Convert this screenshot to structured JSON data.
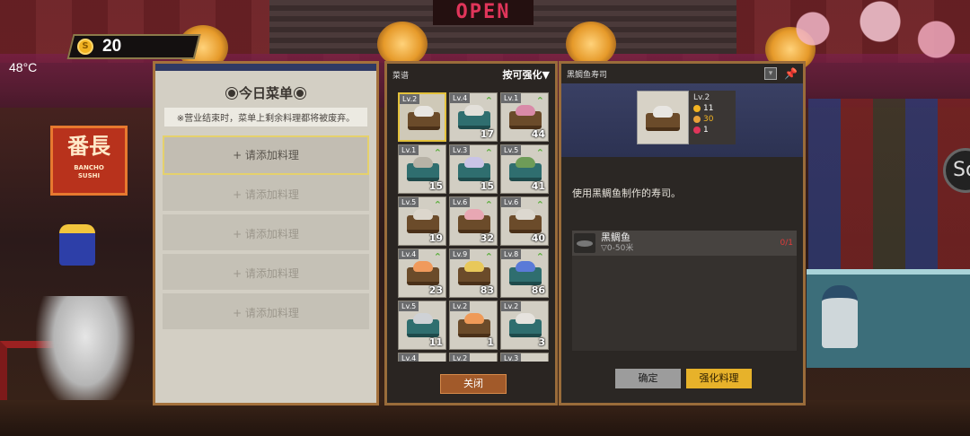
{
  "hud": {
    "temperature": "48°C",
    "coins": "20",
    "coin_symbol": "S",
    "open_sign": "OPEN",
    "side_button": "So"
  },
  "signboard": {
    "name": "番長",
    "sub1": "BANCHO",
    "sub2": "SUSHI"
  },
  "today_menu": {
    "title": "今日菜单",
    "note": "※营业结束时，菜单上剩余料理都将被废弃。",
    "slots": [
      "+ 请添加料理",
      "+ 请添加料理",
      "+ 请添加料理",
      "+ 请添加料理",
      "+ 请添加料理"
    ]
  },
  "recipes": {
    "title": "菜谱",
    "sort_label": "按可强化▼",
    "close_label": "关闭",
    "items": [
      {
        "level": "Lv.2",
        "count": "",
        "upgrade": false,
        "selected": true,
        "fish": "#e8e6e2",
        "plate": "wood"
      },
      {
        "level": "Lv.4",
        "count": "17",
        "upgrade": true,
        "selected": false,
        "fish": "#e3e0da",
        "plate": "teal"
      },
      {
        "level": "Lv.1",
        "count": "44",
        "upgrade": true,
        "selected": false,
        "fish": "#d98aa8",
        "plate": "wood"
      },
      {
        "level": "Lv.1",
        "count": "15",
        "upgrade": true,
        "selected": false,
        "fish": "#b7b2a6",
        "plate": "teal"
      },
      {
        "level": "Lv.3",
        "count": "15",
        "upgrade": true,
        "selected": false,
        "fish": "#c9c4e6",
        "plate": "teal"
      },
      {
        "level": "Lv.5",
        "count": "41",
        "upgrade": true,
        "selected": false,
        "fish": "#6e9c58",
        "plate": "teal"
      },
      {
        "level": "Lv.5",
        "count": "19",
        "upgrade": true,
        "selected": false,
        "fish": "#dcd6cc",
        "plate": "wood"
      },
      {
        "level": "Lv.6",
        "count": "32",
        "upgrade": true,
        "selected": false,
        "fish": "#e8a7b3",
        "plate": "wood"
      },
      {
        "level": "Lv.6",
        "count": "40",
        "upgrade": true,
        "selected": false,
        "fish": "#dcd8cf",
        "plate": "wood"
      },
      {
        "level": "Lv.4",
        "count": "23",
        "upgrade": true,
        "selected": false,
        "fish": "#f09a5c",
        "plate": "wood"
      },
      {
        "level": "Lv.9",
        "count": "83",
        "upgrade": true,
        "selected": false,
        "fish": "#e8c85a",
        "plate": "wood"
      },
      {
        "level": "Lv.8",
        "count": "86",
        "upgrade": true,
        "selected": false,
        "fish": "#5a7ad8",
        "plate": "teal"
      },
      {
        "level": "Lv.5",
        "count": "11",
        "upgrade": false,
        "selected": false,
        "fish": "#cfd2d6",
        "plate": "teal"
      },
      {
        "level": "Lv.2",
        "count": "1",
        "upgrade": false,
        "selected": false,
        "fish": "#ef9a58",
        "plate": "wood"
      },
      {
        "level": "Lv.2",
        "count": "3",
        "upgrade": false,
        "selected": false,
        "fish": "#e6e3de",
        "plate": "teal"
      },
      {
        "level": "Lv.4",
        "count": "",
        "upgrade": false,
        "selected": false,
        "fish": "#d8d4cc",
        "plate": "teal"
      },
      {
        "level": "Lv.2",
        "count": "",
        "upgrade": false,
        "selected": false,
        "fish": "#d8d4cc",
        "plate": "wood"
      },
      {
        "level": "Lv.3",
        "count": "",
        "upgrade": false,
        "selected": false,
        "fish": "#d8d4cc",
        "plate": "teal"
      }
    ]
  },
  "detail": {
    "title": "黑鲷鱼寿司",
    "level": "Lv.2",
    "stat_coin": "11",
    "stat_taste": "30",
    "stat_count": "1",
    "description": "使用黑鲷鱼制作的寿司。",
    "ingredient_name": "黑鲷鱼",
    "ingredient_depth": "▽0-50米",
    "ingredient_count": "0/1",
    "confirm_label": "确定",
    "enhance_label": "强化料理",
    "colors": {
      "coin": "#f2b322",
      "taste": "#f2b322",
      "count": "#e0355a"
    }
  }
}
